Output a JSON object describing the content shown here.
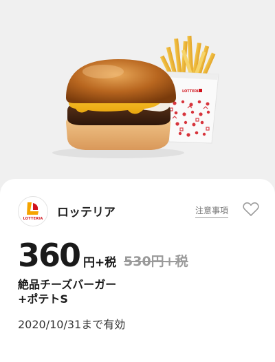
{
  "coupon": {
    "brand_name": "ロッテリア",
    "brand_logo_text": "LOTTERIA",
    "notice_label": "注意事項",
    "favorite_icon": "heart-outline-icon",
    "price": "360",
    "price_suffix": "円+税",
    "original_price": "530円+税",
    "item_name_line1": "絶品チーズバーガー",
    "item_name_line2": "+ポテトS",
    "expiry": "2020/10/31まで有効",
    "fries_box_logo_text": "LOTTERIA"
  },
  "colors": {
    "brand_red": "#d1121b",
    "brand_yellow": "#f5a400",
    "strikethrough_gray": "#9a9a9a"
  }
}
